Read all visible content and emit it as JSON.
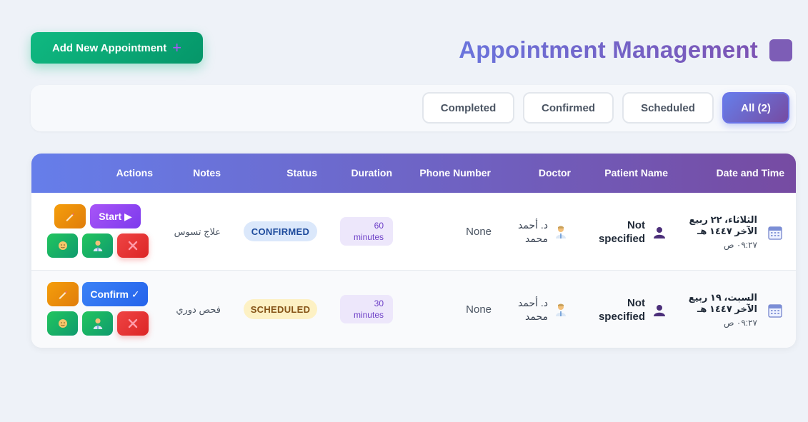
{
  "header": {
    "add_button_label": "Add New Appointment",
    "add_button_icon": "+",
    "title": "Appointment Management"
  },
  "filters": [
    {
      "label": "All (2)",
      "active": true
    },
    {
      "label": "Scheduled",
      "active": false
    },
    {
      "label": "Confirmed",
      "active": false
    },
    {
      "label": "Completed",
      "active": false
    }
  ],
  "table": {
    "columns": [
      "Date and Time",
      "Patient Name",
      "Doctor",
      "Phone Number",
      "Duration",
      "Status",
      "Notes",
      "Actions"
    ],
    "rows": [
      {
        "date": "الثلاثاء، ٢٢ ربيع الآخر ١٤٤٧ هـ",
        "time": "٠٩:٢٧ ص",
        "patient": "Not specified",
        "doctor": "د. أحمد محمد",
        "phone": "None",
        "duration_value": "60",
        "duration_unit": "minutes",
        "status": "CONFIRMED",
        "notes": "علاج تسوس",
        "primary_action": "Start ▶"
      },
      {
        "date": "السبت، ١٩ ربيع الآخر ١٤٤٧ هـ",
        "time": "٠٩:٢٧ ص",
        "patient": "Not specified",
        "doctor": "د. أحمد محمد",
        "phone": "None",
        "duration_value": "30",
        "duration_unit": "minutes",
        "status": "SCHEDULED",
        "notes": "فحص دوري",
        "primary_action": "Confirm ✓"
      }
    ]
  },
  "icons": {
    "edit": "pencil-icon",
    "patient": "patient-icon",
    "doctor": "doctor-icon",
    "cancel": "close-icon",
    "calendar": "calendar-icon"
  },
  "colors": {
    "accent_start": "#667eea",
    "accent_end": "#764ba2",
    "add_green": "#10b981",
    "cancel_red": "#ef4444"
  }
}
